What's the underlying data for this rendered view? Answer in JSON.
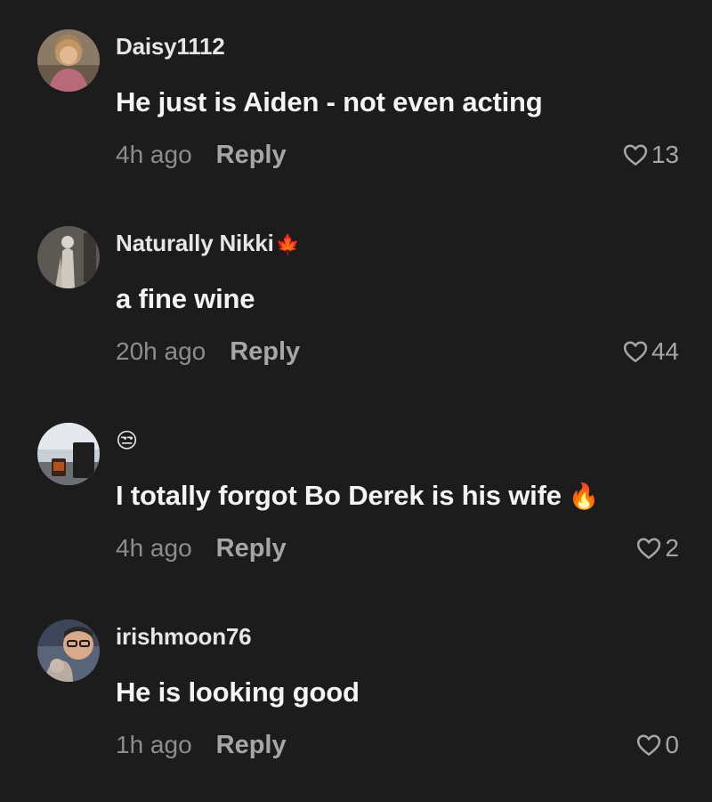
{
  "comments": [
    {
      "username": "Daisy1112",
      "flair": "",
      "text": "He just is Aiden - not even acting",
      "text_suffix": "",
      "time": "4h ago",
      "reply_label": "Reply",
      "likes": "13"
    },
    {
      "username": "Naturally Nikki",
      "flair": "🍁",
      "text": "a fine wine",
      "text_suffix": "",
      "time": "20h ago",
      "reply_label": "Reply",
      "likes": "44"
    },
    {
      "username": "😒",
      "flair": "",
      "text": "I totally forgot Bo Derek is his wife",
      "text_suffix": "🔥",
      "time": "4h ago",
      "reply_label": "Reply",
      "likes": "2"
    },
    {
      "username": "irishmoon76",
      "flair": "",
      "text": "He is looking good",
      "text_suffix": "",
      "time": "1h ago",
      "reply_label": "Reply",
      "likes": "0"
    }
  ],
  "colors": {
    "background": "#1c1c1c",
    "text": "#f4f4f4",
    "muted": "#8d8d8d",
    "reply": "#a6a6a6"
  },
  "icons": {
    "like": "heart-outline-icon"
  }
}
